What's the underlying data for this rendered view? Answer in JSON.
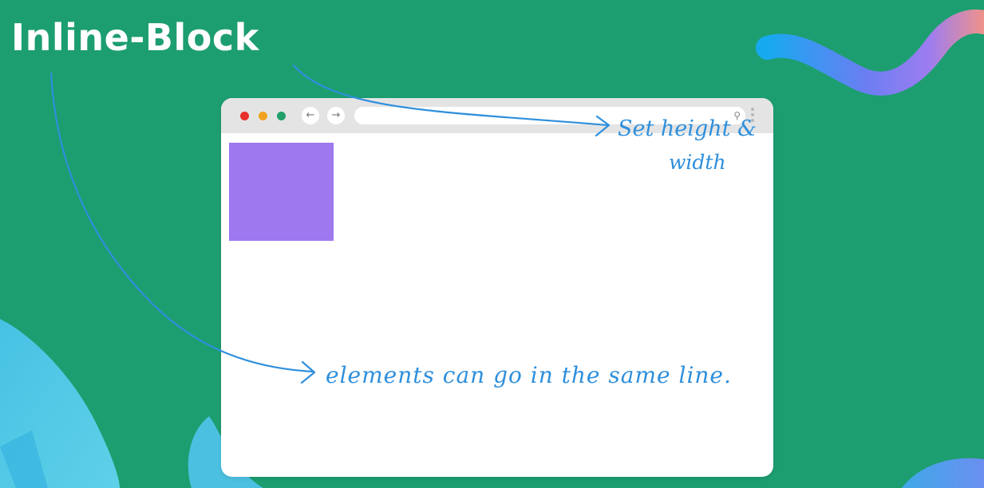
{
  "slide": {
    "title": "Inline-Block",
    "annotation_height_width_line1": "Set height &",
    "annotation_height_width_line2": "width",
    "annotation_same_line": "elements can go in the same line."
  },
  "browser": {
    "back_icon": "←",
    "forward_icon": "→",
    "search_icon": "⚲"
  },
  "colors": {
    "background": "#1d9e70",
    "box": "#9d78ee",
    "annotation": "#2e8fdc"
  },
  "icons": {
    "traffic_lights": [
      "close-dot",
      "minimize-dot",
      "maximize-dot"
    ],
    "navigation": [
      "back-arrow-icon",
      "forward-arrow-icon"
    ],
    "address_bar": "search-icon",
    "menu": "more-vertical-icon"
  }
}
